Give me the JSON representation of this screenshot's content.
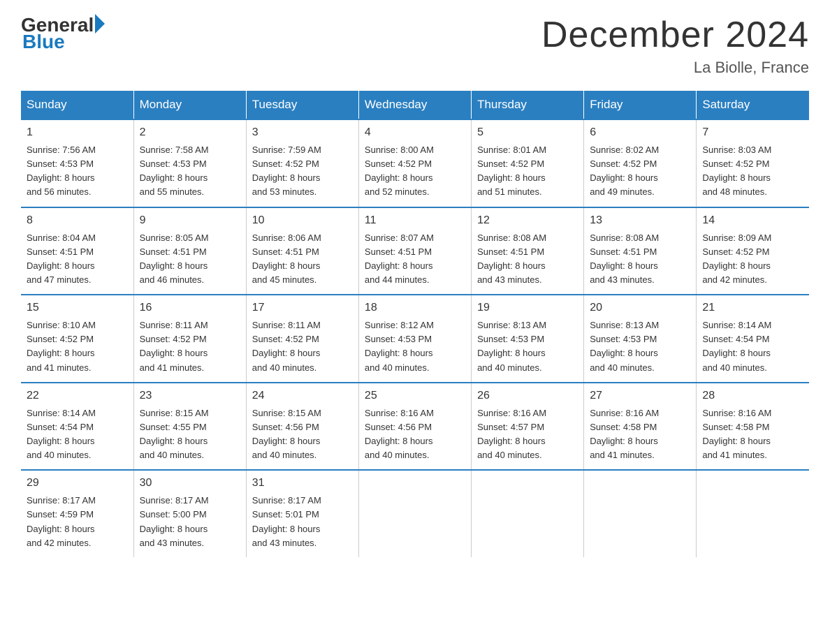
{
  "header": {
    "logo_general": "General",
    "logo_blue": "Blue",
    "title": "December 2024",
    "location": "La Biolle, France"
  },
  "days_of_week": [
    "Sunday",
    "Monday",
    "Tuesday",
    "Wednesday",
    "Thursday",
    "Friday",
    "Saturday"
  ],
  "weeks": [
    [
      {
        "day": "1",
        "sunrise": "7:56 AM",
        "sunset": "4:53 PM",
        "daylight": "8 hours and 56 minutes."
      },
      {
        "day": "2",
        "sunrise": "7:58 AM",
        "sunset": "4:53 PM",
        "daylight": "8 hours and 55 minutes."
      },
      {
        "day": "3",
        "sunrise": "7:59 AM",
        "sunset": "4:52 PM",
        "daylight": "8 hours and 53 minutes."
      },
      {
        "day": "4",
        "sunrise": "8:00 AM",
        "sunset": "4:52 PM",
        "daylight": "8 hours and 52 minutes."
      },
      {
        "day": "5",
        "sunrise": "8:01 AM",
        "sunset": "4:52 PM",
        "daylight": "8 hours and 51 minutes."
      },
      {
        "day": "6",
        "sunrise": "8:02 AM",
        "sunset": "4:52 PM",
        "daylight": "8 hours and 49 minutes."
      },
      {
        "day": "7",
        "sunrise": "8:03 AM",
        "sunset": "4:52 PM",
        "daylight": "8 hours and 48 minutes."
      }
    ],
    [
      {
        "day": "8",
        "sunrise": "8:04 AM",
        "sunset": "4:51 PM",
        "daylight": "8 hours and 47 minutes."
      },
      {
        "day": "9",
        "sunrise": "8:05 AM",
        "sunset": "4:51 PM",
        "daylight": "8 hours and 46 minutes."
      },
      {
        "day": "10",
        "sunrise": "8:06 AM",
        "sunset": "4:51 PM",
        "daylight": "8 hours and 45 minutes."
      },
      {
        "day": "11",
        "sunrise": "8:07 AM",
        "sunset": "4:51 PM",
        "daylight": "8 hours and 44 minutes."
      },
      {
        "day": "12",
        "sunrise": "8:08 AM",
        "sunset": "4:51 PM",
        "daylight": "8 hours and 43 minutes."
      },
      {
        "day": "13",
        "sunrise": "8:08 AM",
        "sunset": "4:51 PM",
        "daylight": "8 hours and 43 minutes."
      },
      {
        "day": "14",
        "sunrise": "8:09 AM",
        "sunset": "4:52 PM",
        "daylight": "8 hours and 42 minutes."
      }
    ],
    [
      {
        "day": "15",
        "sunrise": "8:10 AM",
        "sunset": "4:52 PM",
        "daylight": "8 hours and 41 minutes."
      },
      {
        "day": "16",
        "sunrise": "8:11 AM",
        "sunset": "4:52 PM",
        "daylight": "8 hours and 41 minutes."
      },
      {
        "day": "17",
        "sunrise": "8:11 AM",
        "sunset": "4:52 PM",
        "daylight": "8 hours and 40 minutes."
      },
      {
        "day": "18",
        "sunrise": "8:12 AM",
        "sunset": "4:53 PM",
        "daylight": "8 hours and 40 minutes."
      },
      {
        "day": "19",
        "sunrise": "8:13 AM",
        "sunset": "4:53 PM",
        "daylight": "8 hours and 40 minutes."
      },
      {
        "day": "20",
        "sunrise": "8:13 AM",
        "sunset": "4:53 PM",
        "daylight": "8 hours and 40 minutes."
      },
      {
        "day": "21",
        "sunrise": "8:14 AM",
        "sunset": "4:54 PM",
        "daylight": "8 hours and 40 minutes."
      }
    ],
    [
      {
        "day": "22",
        "sunrise": "8:14 AM",
        "sunset": "4:54 PM",
        "daylight": "8 hours and 40 minutes."
      },
      {
        "day": "23",
        "sunrise": "8:15 AM",
        "sunset": "4:55 PM",
        "daylight": "8 hours and 40 minutes."
      },
      {
        "day": "24",
        "sunrise": "8:15 AM",
        "sunset": "4:56 PM",
        "daylight": "8 hours and 40 minutes."
      },
      {
        "day": "25",
        "sunrise": "8:16 AM",
        "sunset": "4:56 PM",
        "daylight": "8 hours and 40 minutes."
      },
      {
        "day": "26",
        "sunrise": "8:16 AM",
        "sunset": "4:57 PM",
        "daylight": "8 hours and 40 minutes."
      },
      {
        "day": "27",
        "sunrise": "8:16 AM",
        "sunset": "4:58 PM",
        "daylight": "8 hours and 41 minutes."
      },
      {
        "day": "28",
        "sunrise": "8:16 AM",
        "sunset": "4:58 PM",
        "daylight": "8 hours and 41 minutes."
      }
    ],
    [
      {
        "day": "29",
        "sunrise": "8:17 AM",
        "sunset": "4:59 PM",
        "daylight": "8 hours and 42 minutes."
      },
      {
        "day": "30",
        "sunrise": "8:17 AM",
        "sunset": "5:00 PM",
        "daylight": "8 hours and 43 minutes."
      },
      {
        "day": "31",
        "sunrise": "8:17 AM",
        "sunset": "5:01 PM",
        "daylight": "8 hours and 43 minutes."
      },
      null,
      null,
      null,
      null
    ]
  ],
  "labels": {
    "sunrise": "Sunrise:",
    "sunset": "Sunset:",
    "daylight": "Daylight:"
  }
}
